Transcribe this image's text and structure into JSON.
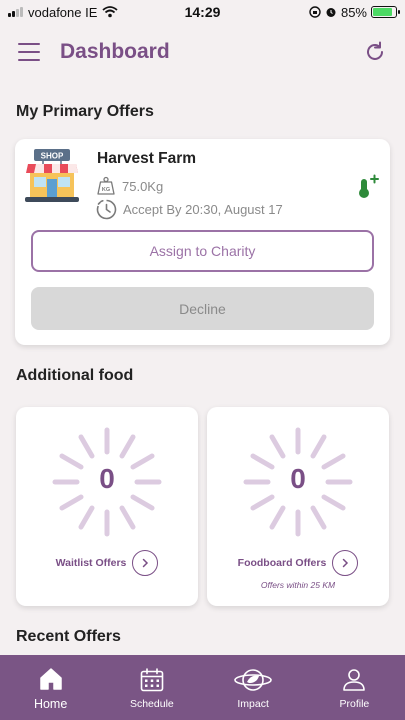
{
  "status_bar": {
    "carrier": "vodafone IE",
    "time": "14:29",
    "battery": "85%",
    "battery_level": 0.85,
    "icons": [
      "signal-icon",
      "wifi-icon",
      "orientation-lock-icon",
      "alarm-icon",
      "battery-charging-icon"
    ]
  },
  "header": {
    "title": "Dashboard",
    "menu_icon": "hamburger-menu-icon",
    "refresh_icon": "refresh-icon"
  },
  "sections": {
    "primary": "My Primary Offers",
    "additional": "Additional food",
    "recent": "Recent Offers"
  },
  "primary_offer": {
    "name": "Harvest Farm",
    "weight": "75.0Kg",
    "accept_by": "Accept By 20:30, August 17",
    "assign_label": "Assign to Charity",
    "decline_label": "Decline",
    "shop_sign": "SHOP",
    "weight_icon_label": "KG"
  },
  "additional_food": [
    {
      "count": "0",
      "label": "Waitlist Offers",
      "sub": ""
    },
    {
      "count": "0",
      "label": "Foodboard Offers",
      "sub": "Offers within 25 KM"
    }
  ],
  "nav": [
    {
      "label": "Home",
      "icon": "home-icon",
      "active": true
    },
    {
      "label": "Schedule",
      "icon": "calendar-icon",
      "active": false
    },
    {
      "label": "Impact",
      "icon": "planet-leaf-icon",
      "active": false
    },
    {
      "label": "Profile",
      "icon": "person-icon",
      "active": false
    }
  ],
  "colors": {
    "brand": "#7a4f86",
    "nav_bg": "#7a5585",
    "accent_green": "#2e8a3a",
    "background": "#f4f0f1"
  }
}
